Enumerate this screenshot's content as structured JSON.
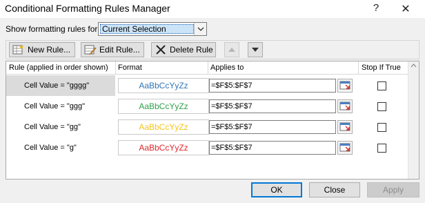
{
  "window": {
    "title": "Conditional Formatting Rules Manager",
    "help_glyph": "?",
    "close_glyph": "✕"
  },
  "show_rules": {
    "label": "Show formatting rules for:",
    "selected": "Current Selection"
  },
  "toolbar": {
    "new_rule": "New Rule...",
    "edit_rule": "Edit Rule...",
    "delete_rule": "Delete Rule"
  },
  "columns": {
    "rule": "Rule (applied in order shown)",
    "format": "Format",
    "applies_to": "Applies to",
    "stop_if_true": "Stop If True"
  },
  "rules": [
    {
      "rule": "Cell Value = \"gggg\"",
      "format_preview": "AaBbCcYyZz",
      "format_color": "#2f75b5",
      "applies_to": "=$F$5:$F$7",
      "stop_if_true": false,
      "selected": true
    },
    {
      "rule": "Cell Value = \"ggg\"",
      "format_preview": "AaBbCcYyZz",
      "format_color": "#2ea04a",
      "applies_to": "=$F$5:$F$7",
      "stop_if_true": false,
      "selected": false
    },
    {
      "rule": "Cell Value = \"gg\"",
      "format_preview": "AaBbCcYyZz",
      "format_color": "#f5c518",
      "applies_to": "=$F$5:$F$7",
      "stop_if_true": false,
      "selected": false
    },
    {
      "rule": "Cell Value = \"g\"",
      "format_preview": "AaBbCcYyZz",
      "format_color": "#e0262b",
      "applies_to": "=$F$5:$F$7",
      "stop_if_true": false,
      "selected": false
    }
  ],
  "footer": {
    "ok": "OK",
    "close": "Close",
    "apply": "Apply"
  }
}
